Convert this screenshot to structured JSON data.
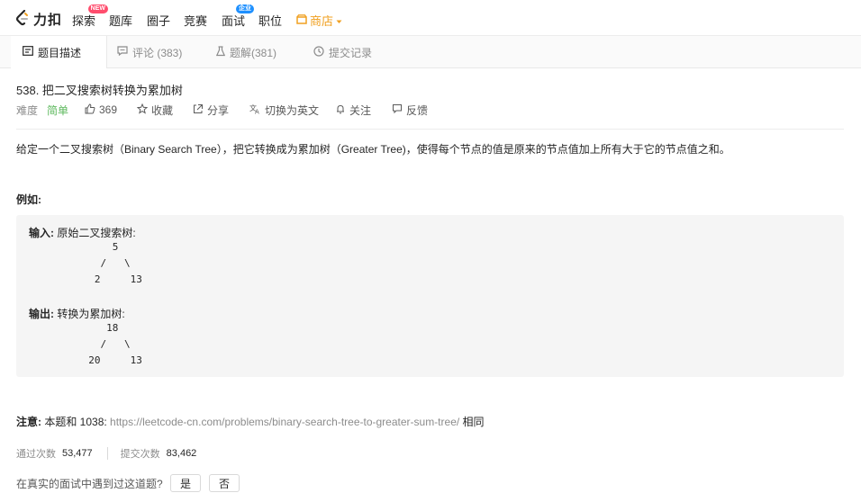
{
  "nav": {
    "brand": "力扣",
    "items": [
      {
        "label": "探索",
        "badge": "NEW"
      },
      {
        "label": "题库"
      },
      {
        "label": "圈子"
      },
      {
        "label": "竞赛"
      },
      {
        "label": "面试",
        "badge": "企业"
      },
      {
        "label": "职位"
      },
      {
        "label": "商店"
      }
    ]
  },
  "tabs": [
    {
      "label": "题目描述",
      "icon": "document-icon"
    },
    {
      "label": "评论 (383)",
      "icon": "comment-icon"
    },
    {
      "label": "题解(381)",
      "icon": "flask-icon"
    },
    {
      "label": "提交记录",
      "icon": "clock-icon"
    }
  ],
  "problem": {
    "title": "538. 把二叉搜索树转换为累加树",
    "difficulty_label": "难度",
    "difficulty": "简单",
    "likes": "369",
    "favorite": "收藏",
    "share": "分享",
    "translate": "切换为英文",
    "follow": "关注",
    "feedback": "反馈",
    "description": "给定一个二叉搜索树（Binary Search Tree），把它转换成为累加树（Greater Tree)，使得每个节点的值是原来的节点值加上所有大于它的节点值之和。",
    "example_heading": "例如:",
    "input_label": "输入:",
    "input_text": " 原始二叉搜索树:",
    "input_tree": "              5\n            /   \\\n           2     13",
    "output_label": "输出:",
    "output_text": " 转换为累加树:",
    "output_tree": "             18\n            /   \\\n          20     13",
    "note_label": "注意:",
    "note_text": " 本题和 1038: ",
    "note_link": "https://leetcode-cn.com/problems/binary-search-tree-to-greater-sum-tree/",
    "note_suffix": " 相同",
    "accepted_label": "通过次数",
    "accepted": "53,477",
    "submissions_label": "提交次数",
    "submissions": "83,462",
    "interview_q": "在真实的面试中遇到过这道题?",
    "yes": "是",
    "no": "否"
  },
  "colors": {
    "accent_orange": "#f0a020",
    "easy_green": "#5cb85c",
    "badge_red": "#ff4d6d",
    "badge_blue": "#1e90ff"
  }
}
